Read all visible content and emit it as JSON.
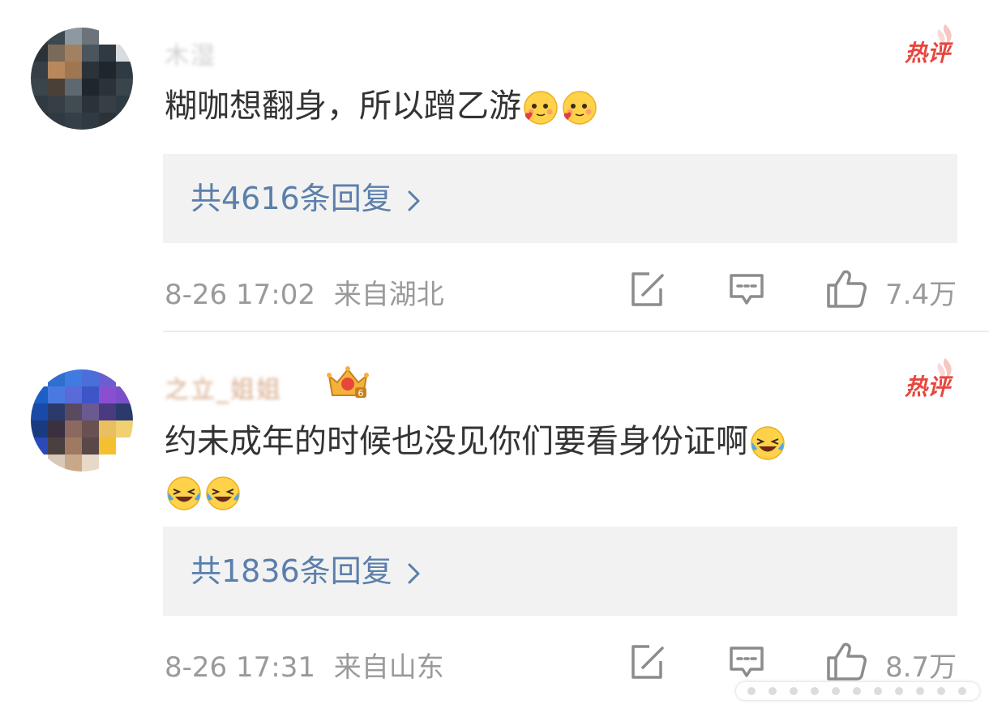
{
  "comments": [
    {
      "username": "木湿",
      "hot_label": "热评",
      "text": "糊咖想翻身，所以蹭乙游",
      "emojis": [
        "blush-heart-emoji",
        "blush-heart-emoji"
      ],
      "replies": "共4616条回复",
      "time": "8-26 17:02",
      "location": "来自湖北",
      "likes": "7.4万"
    },
    {
      "username": "之立_姐姐",
      "hot_label": "热评",
      "text": "约未成年的时候也没见你们要看身份证啊",
      "emojis": [
        "laugh-cry-emoji",
        "laugh-cry-emoji",
        "laugh-cry-emoji"
      ],
      "replies": "共1836条回复",
      "time": "8-26 17:31",
      "location": "来自山东",
      "likes": "8.7万"
    }
  ],
  "icons": {
    "share": "share-icon",
    "comment": "comment-icon",
    "like": "thumbs-up-icon",
    "fan_badge": "crown-fan-badge-icon"
  },
  "colors": {
    "hot": "#e8453c",
    "link": "#5b7fab",
    "meta": "#9a9a9a",
    "reply_bg": "#f2f2f2"
  }
}
